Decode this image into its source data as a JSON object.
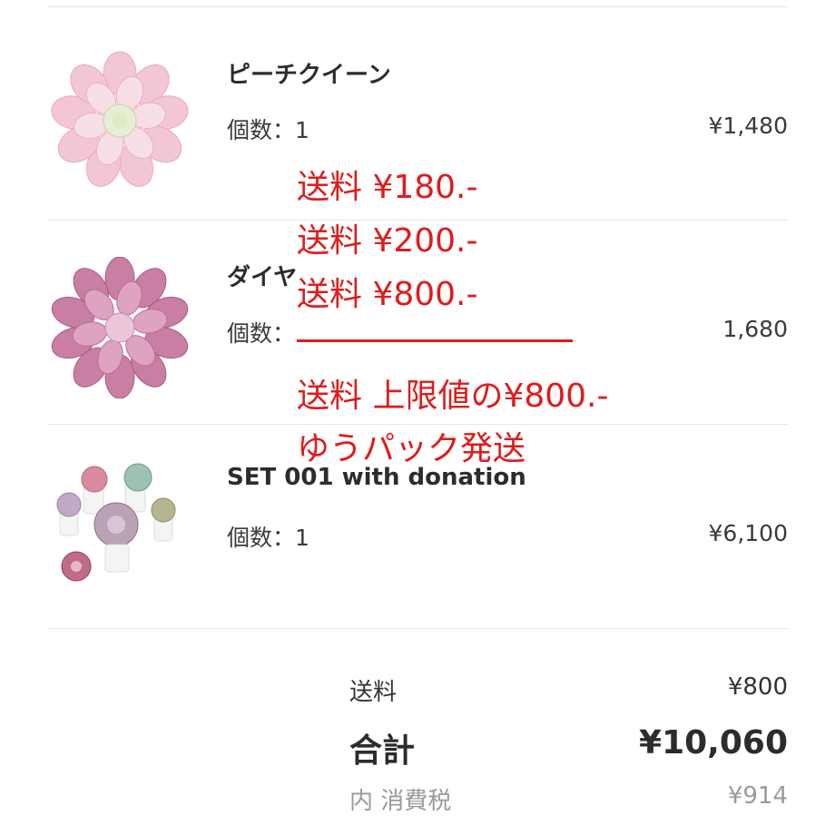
{
  "items": [
    {
      "name": "ピーチクイーン",
      "qty": "個数：1",
      "price": "¥1,480",
      "image": "succulent-pink-rosette"
    },
    {
      "name": "ダイヤ",
      "qty": "個数：",
      "price": "1,680",
      "image": "succulent-purple-rosette"
    },
    {
      "name": "SET 001 with donation",
      "qty": "個数：1",
      "price": "¥6,100",
      "image": "succulent-set"
    }
  ],
  "summary": {
    "shipping_label": "送料",
    "shipping_value": "¥800",
    "total_label": "合計",
    "total_value": "¥10,060",
    "tax_label": "内 消費税",
    "tax_value": "¥914"
  },
  "annotation": {
    "lines": [
      "送料 ¥180.-",
      "送料 ¥200.-",
      "送料 ¥800.-"
    ],
    "result": "送料 上限値の¥800.-",
    "method": "ゆうパック発送",
    "color": "#e01b1b"
  }
}
